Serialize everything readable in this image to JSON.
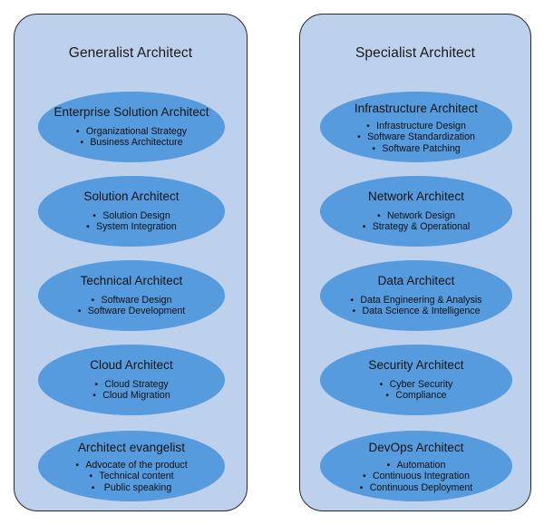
{
  "diagram": {
    "type": "two-column-grouping",
    "background_color": "#ffffff",
    "panel_fill": "#BDD0EC",
    "panel_border": "#2a2a2a",
    "ellipse_fill": "#559BDE",
    "text_color": "#131313",
    "bullet_glyph": "•"
  },
  "columns": [
    {
      "title": "Generalist Architect",
      "roles": [
        {
          "name": "Enterprise Solution Architect",
          "bullets": [
            "Organizational Strategy",
            "Business Architecture"
          ]
        },
        {
          "name": "Solution Architect",
          "bullets": [
            "Solution Design",
            "System Integration"
          ]
        },
        {
          "name": "Technical Architect",
          "bullets": [
            "Software Design",
            "Software Development"
          ]
        },
        {
          "name": "Cloud Architect",
          "bullets": [
            "Cloud Strategy",
            "Cloud Migration"
          ]
        },
        {
          "name": "Architect evangelist",
          "bullets": [
            "Advocate of the product",
            "Technical content",
            " Public speaking"
          ]
        }
      ]
    },
    {
      "title": "Specialist Architect",
      "roles": [
        {
          "name": "Infrastructure Architect",
          "bullets": [
            "Infrastructure Design",
            "Software Standardization",
            "Software Patching"
          ]
        },
        {
          "name": "Network Architect",
          "bullets": [
            "Network Design",
            "Strategy & Operational"
          ]
        },
        {
          "name": "Data Architect",
          "bullets": [
            "Data Engineering & Analysis",
            "Data Science & Intelligence"
          ]
        },
        {
          "name": "Security Architect",
          "bullets": [
            "Cyber Security",
            "Compliance"
          ]
        },
        {
          "name": "DevOps Architect",
          "bullets": [
            "Automation",
            "Continuous Integration",
            "Continuous Deployment"
          ]
        }
      ]
    }
  ]
}
